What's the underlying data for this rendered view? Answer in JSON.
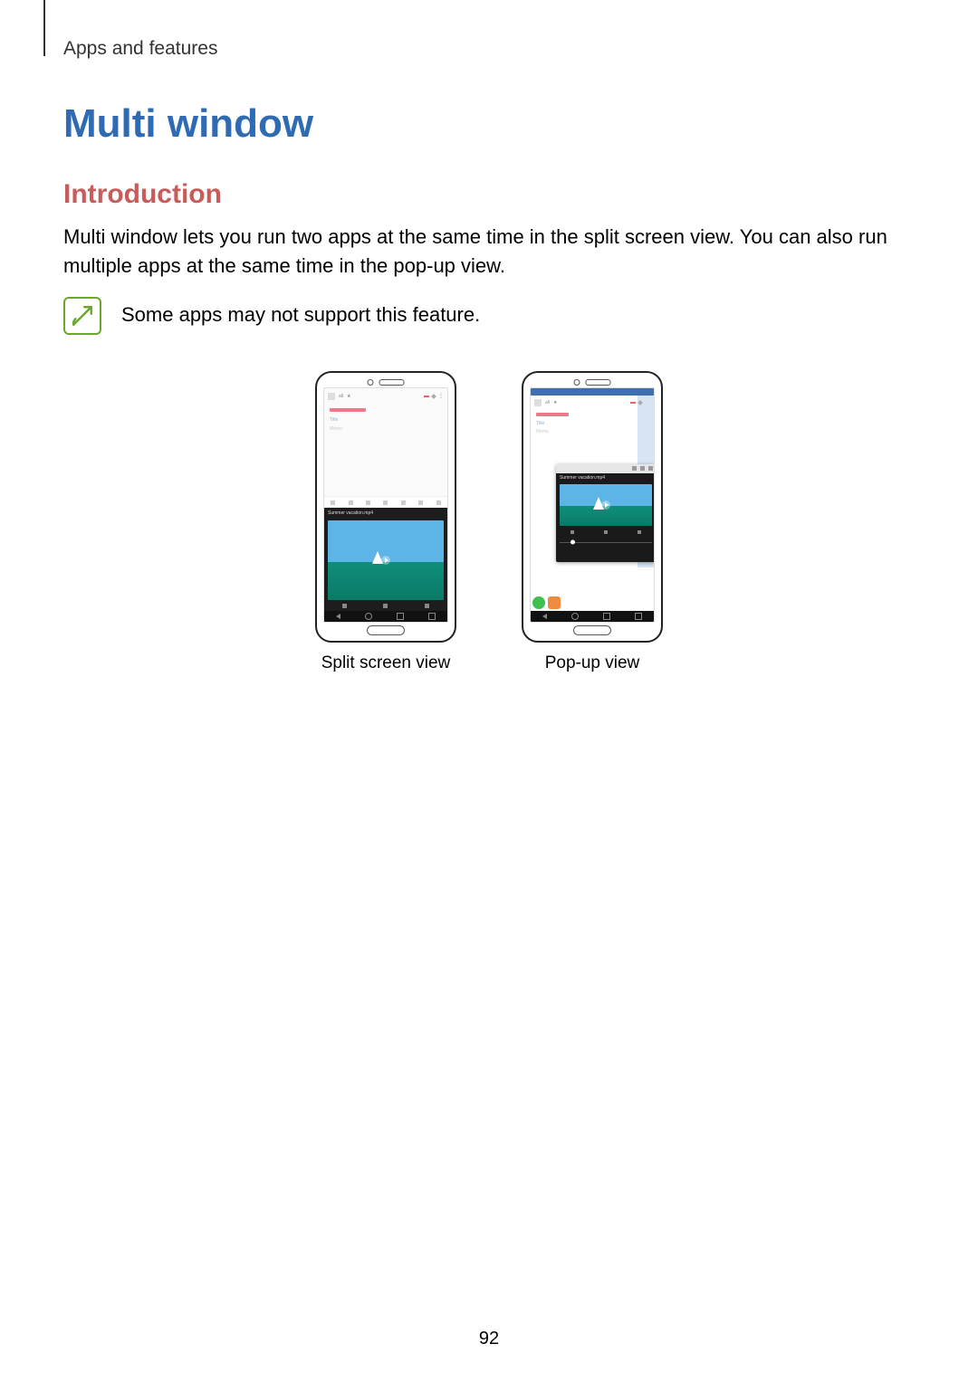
{
  "header": {
    "breadcrumb": "Apps and features"
  },
  "title": "Multi window",
  "subtitle": "Introduction",
  "paragraph": "Multi window lets you run two apps at the same time in the split screen view. You can also run multiple apps at the same time in the pop-up view.",
  "note": "Some apps may not support this feature.",
  "figures": {
    "split_caption": "Split screen view",
    "popup_caption": "Pop-up view"
  },
  "page_number": "92"
}
